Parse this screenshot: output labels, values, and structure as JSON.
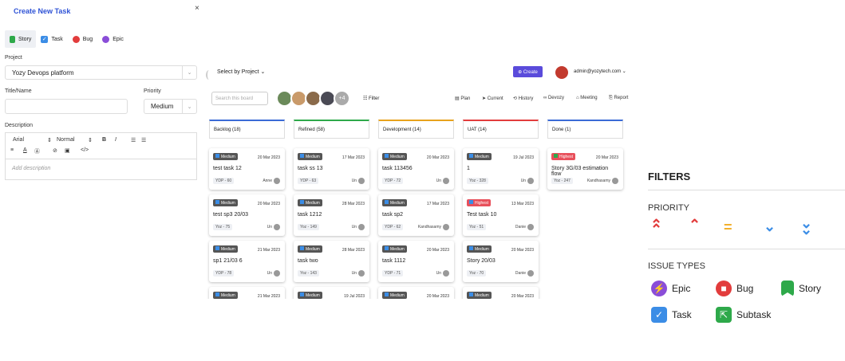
{
  "panel": {
    "title": "Create New Task",
    "close": "×",
    "types": [
      {
        "label": "Story",
        "color": "#2ea94a",
        "icon": "bookmark-icon"
      },
      {
        "label": "Task",
        "color": "#3b8de6",
        "icon": "check-icon"
      },
      {
        "label": "Bug",
        "color": "#e23c3c",
        "icon": "bug-icon"
      },
      {
        "label": "Epic",
        "color": "#8a4dd8",
        "icon": "lightning-icon"
      }
    ],
    "project_label": "Project",
    "project_value": "Yozy Devops platform",
    "title_label": "Title/Name",
    "priority_label": "Priority",
    "priority_value": "Medium",
    "description_label": "Description",
    "editor": {
      "font": "Arial",
      "size": "Normal",
      "placeholder": "Add description"
    }
  },
  "board": {
    "select_project": "Select by Project ⌄",
    "create": "⊕ Create",
    "admin": "admin@yozytech.com ⌄",
    "search_placeholder": "Search this board",
    "more_count": "+4",
    "filter": "☷ Filter",
    "toolbar": [
      "▤ Plan",
      "➤ Current",
      "⟲ History",
      "∞ Devozy",
      "⌂ Meeting",
      "⎘ Report"
    ],
    "columns": [
      {
        "name": "Backlog (18)",
        "color": "#3b6bd6",
        "cards": [
          {
            "badge": "Medium",
            "badge_color": "#555",
            "date": "20 Mar 2023",
            "title": "test task 12",
            "tag": "YDP - 60",
            "assignee": "Anne"
          },
          {
            "badge": "Medium",
            "badge_color": "#555",
            "date": "20 Mar 2023",
            "title": "test sp3 20/03",
            "tag": "Yoz - 75",
            "assignee": "Un"
          },
          {
            "badge": "Medium",
            "badge_color": "#555",
            "date": "21 Mar 2023",
            "title": "sp1 21/03 6",
            "tag": "YDP - 78",
            "assignee": "Un"
          },
          {
            "badge": "Medium",
            "badge_color": "#555",
            "date": "21 Mar 2023",
            "title": "",
            "tag": "",
            "assignee": ""
          }
        ]
      },
      {
        "name": "Refined (58)",
        "color": "#2ea94a",
        "cards": [
          {
            "badge": "Medium",
            "badge_color": "#555",
            "date": "17 Mar 2023",
            "title": "task ss 13",
            "tag": "YDP - 63",
            "assignee": "Un"
          },
          {
            "badge": "Medium",
            "badge_color": "#555",
            "date": "28 Mar 2023",
            "title": "task 1212",
            "tag": "Yoz - 149",
            "assignee": "Un"
          },
          {
            "badge": "Medium",
            "badge_color": "#555",
            "date": "28 Mar 2023",
            "title": "task two",
            "tag": "Yoz - 143",
            "assignee": "Un"
          },
          {
            "badge": "Medium",
            "badge_color": "#555",
            "date": "19 Jul 2023",
            "title": "",
            "tag": "",
            "assignee": ""
          }
        ]
      },
      {
        "name": "Development (14)",
        "color": "#e8a21c",
        "cards": [
          {
            "badge": "Medium",
            "badge_color": "#555",
            "date": "20 Mar 2023",
            "title": "task 113456",
            "tag": "YDP - 72",
            "assignee": "Un"
          },
          {
            "badge": "Medium",
            "badge_color": "#555",
            "date": "17 Mar 2023",
            "title": "task sp2",
            "tag": "YDP - 62",
            "assignee": "Kandhasamy"
          },
          {
            "badge": "Medium",
            "badge_color": "#555",
            "date": "20 Mar 2023",
            "title": "task 1112",
            "tag": "YDP - 71",
            "assignee": "Un"
          },
          {
            "badge": "Medium",
            "badge_color": "#555",
            "date": "20 Mar 2023",
            "title": "",
            "tag": "",
            "assignee": ""
          }
        ]
      },
      {
        "name": "UAT (14)",
        "color": "#e23c3c",
        "cards": [
          {
            "badge": "Medium",
            "badge_color": "#555",
            "date": "19 Jul 2023",
            "title": "1",
            "tag": "Yoz - 328",
            "assignee": "Un"
          },
          {
            "badge": "Highest",
            "badge_color": "#e8505b",
            "date": "13 Mar 2023",
            "title": "Test task 10",
            "tag": "Yoz - 51",
            "assignee": "Danie"
          },
          {
            "badge": "Medium",
            "badge_color": "#555",
            "date": "20 Mar 2023",
            "title": "Story 20/03",
            "tag": "Yoz - 70",
            "assignee": "Danie"
          },
          {
            "badge": "Medium",
            "badge_color": "#555",
            "date": "20 Mar 2023",
            "title": "",
            "tag": "",
            "assignee": ""
          }
        ]
      },
      {
        "name": "Done (1)",
        "color": "#3b6bd6",
        "cards": [
          {
            "badge": "Highest",
            "badge_color": "#e8505b",
            "date": "20 Mar 2023",
            "title": "Story 3G/03 estimation flow",
            "tag": "Yoz - 247",
            "assignee": "Kandhasamy"
          }
        ]
      }
    ]
  },
  "filters": {
    "title": "FILTERS",
    "priority_title": "PRIORITY",
    "priorities": [
      {
        "icon": "highest-icon",
        "glyph": "⌃⌃",
        "color": "#e23c3c"
      },
      {
        "icon": "high-icon",
        "glyph": "⌃",
        "color": "#e23c3c"
      },
      {
        "icon": "medium-icon",
        "glyph": "=",
        "color": "#f2b02c"
      },
      {
        "icon": "low-icon",
        "glyph": "⌄",
        "color": "#3b8de6"
      },
      {
        "icon": "lowest-icon",
        "glyph": "⌄⌄",
        "color": "#3b8de6"
      }
    ],
    "issue_title": "ISSUE TYPES",
    "types": [
      {
        "label": "Epic",
        "color": "#8a4dd8",
        "icon": "lightning-icon",
        "glyph": "⚡"
      },
      {
        "label": "Bug",
        "color": "#e23c3c",
        "icon": "bug-icon",
        "glyph": "■"
      },
      {
        "label": "Story",
        "color": "#2ea94a",
        "icon": "bookmark-icon",
        "glyph": ""
      },
      {
        "label": "Task",
        "color": "#3b8de6",
        "icon": "check-icon",
        "glyph": "✓"
      },
      {
        "label": "Subtask",
        "color": "#2ea94a",
        "icon": "subtask-icon",
        "glyph": "⇱"
      }
    ]
  }
}
